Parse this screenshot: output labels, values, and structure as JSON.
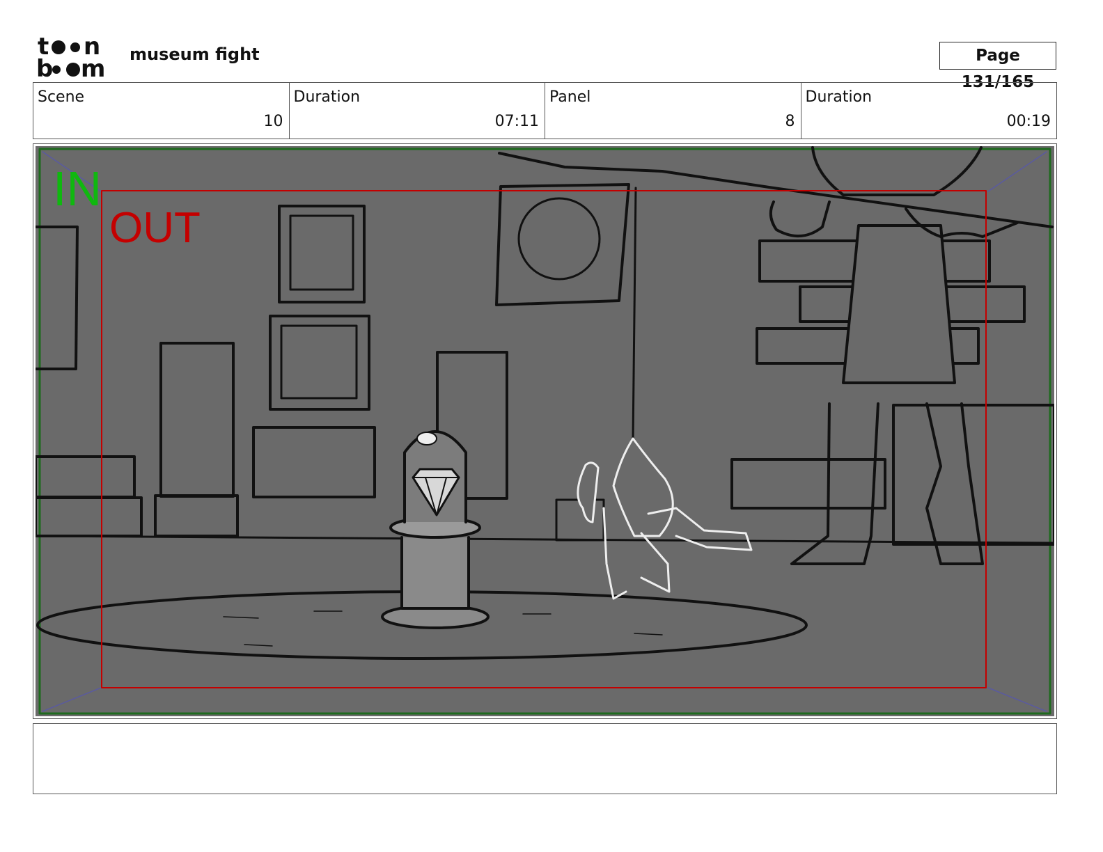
{
  "header": {
    "logo_text": "toon boom",
    "project_title": "museum fight",
    "page_label": "Page 131/165"
  },
  "info": {
    "scene_label": "Scene",
    "scene_value": "10",
    "scene_duration_label": "Duration",
    "scene_duration_value": "07:11",
    "panel_label": "Panel",
    "panel_value": "8",
    "panel_duration_label": "Duration",
    "panel_duration_value": "00:19"
  },
  "frame": {
    "in_label": "IN",
    "out_label": "OUT",
    "in_color": "#0fb80f",
    "out_color": "#c40000",
    "background_color": "#6a6a6a"
  },
  "caption": {
    "text": ""
  }
}
